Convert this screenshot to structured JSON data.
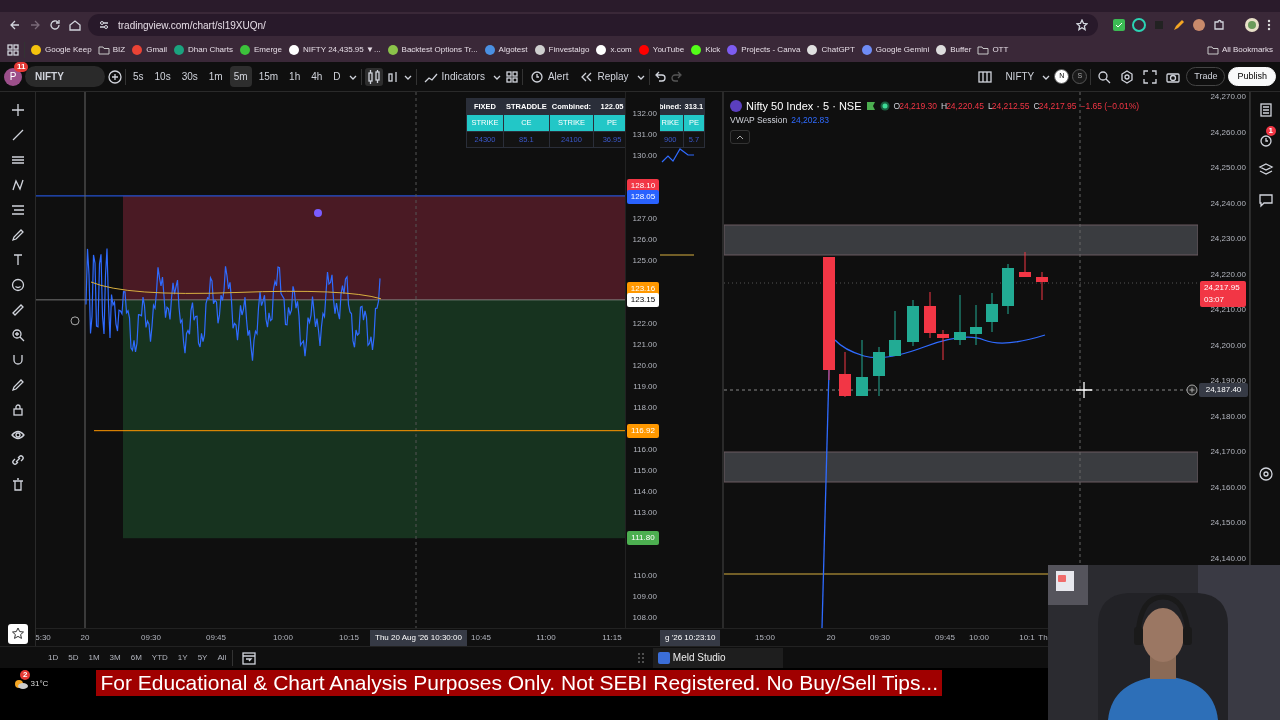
{
  "browser": {
    "url": "tradingview.com/chart/sl19XUQn/",
    "all_bookmarks": "All Bookmarks",
    "bookmarks": [
      {
        "label": "Google Keep",
        "kind": "site",
        "color": "#f4c20d"
      },
      {
        "label": "BIZ",
        "kind": "folder"
      },
      {
        "label": "Gmail",
        "kind": "site",
        "color": "#ea4335"
      },
      {
        "label": "Dhan Charts",
        "kind": "site",
        "color": "#1ba37f"
      },
      {
        "label": "Emerge",
        "kind": "site",
        "color": "#3cc13b"
      },
      {
        "label": "NIFTY 24,435.95 ▼...",
        "kind": "site",
        "color": "#ffffff"
      },
      {
        "label": "Backtest Options Tr...",
        "kind": "site",
        "color": "#8bc34a"
      },
      {
        "label": "Algotest",
        "kind": "site",
        "color": "#4a90e2"
      },
      {
        "label": "Finvestalgo",
        "kind": "site",
        "color": "#cfcfcf"
      },
      {
        "label": "x.com",
        "kind": "site",
        "color": "#ffffff"
      },
      {
        "label": "YouTube",
        "kind": "site",
        "color": "#ff0000"
      },
      {
        "label": "Kick",
        "kind": "site",
        "color": "#53fc18"
      },
      {
        "label": "Projects - Canva",
        "kind": "site",
        "color": "#7d5cf0"
      },
      {
        "label": "ChatGPT",
        "kind": "site",
        "color": "#e0e0e0"
      },
      {
        "label": "Google Gemini",
        "kind": "site",
        "color": "#6f8cf5"
      },
      {
        "label": "Buffer",
        "kind": "site",
        "color": "#dddddd"
      },
      {
        "label": "OTT",
        "kind": "folder"
      }
    ]
  },
  "toolbar": {
    "avatar": "P",
    "notifications": "11",
    "symbol": "NIFTY",
    "intervals": [
      {
        "label": "5s",
        "selected": false
      },
      {
        "label": "10s",
        "selected": false
      },
      {
        "label": "30s",
        "selected": false
      },
      {
        "label": "1m",
        "selected": false
      },
      {
        "label": "5m",
        "selected": true
      },
      {
        "label": "15m",
        "selected": false
      },
      {
        "label": "1h",
        "selected": false
      },
      {
        "label": "4h",
        "selected": false
      },
      {
        "label": "D",
        "selected": false
      }
    ],
    "indicators": "Indicators",
    "alert": "Alert",
    "replay": "Replay",
    "symbol_right": "NIFTY",
    "badges": [
      "N",
      "S"
    ],
    "trade": "Trade",
    "publish": "Publish"
  },
  "left_chart": {
    "tables": [
      {
        "header": [
          "FIXED",
          "STRADDLE",
          "Combined:",
          "122.05"
        ],
        "columns": [
          "STRIKE",
          "CE",
          "STRIKE",
          "PE"
        ],
        "values": [
          "24300",
          "85.1",
          "24100",
          "36.95"
        ]
      },
      {
        "header": [
          "bined:",
          "313.1"
        ],
        "columns": [
          "RIKE",
          "PE"
        ],
        "values": [
          "900",
          "5.7"
        ]
      }
    ],
    "price_ticks": [
      "132.00",
      "131.00",
      "130.00",
      "127.00",
      "126.00",
      "125.00",
      "122.00",
      "121.00",
      "120.00",
      "119.00",
      "118.00",
      "116.00",
      "115.00",
      "114.00",
      "113.00",
      "110.00",
      "109.00",
      "108.00"
    ],
    "price_tags": [
      {
        "label": "128.10",
        "color": "#f23645"
      },
      {
        "label": "128.05",
        "color": "#2962ff"
      },
      {
        "label": "123.16",
        "color": "#ff9800"
      },
      {
        "label": "123.15",
        "color": "#ffffff"
      },
      {
        "label": "116.92",
        "color": "#ff9800"
      },
      {
        "label": "111.80",
        "color": "#4caf50"
      }
    ],
    "time_labels": [
      "5:30",
      "20",
      "09:30",
      "09:45",
      "10:00",
      "10:15",
      "10:45",
      "11:00",
      "11:15"
    ],
    "crosshair_time": "Thu 20 Aug '26  10:30:00"
  },
  "middle_panel": {
    "crosshair_time": "g '26  10:23:10"
  },
  "right_chart": {
    "title": "Nifty 50 Index · 5 · NSE",
    "ohlc": [
      {
        "key": "O",
        "value": "24,219.30"
      },
      {
        "key": "H",
        "value": "24,220.45"
      },
      {
        "key": "L",
        "value": "24,212.55"
      },
      {
        "key": "C",
        "value": "24,217.95"
      }
    ],
    "change": "−1.65 (−0.01%)",
    "indicator": "VWAP Session",
    "indicator_value": "24,202.83",
    "price_ticks": [
      "24,270.00",
      "24,260.00",
      "24,250.00",
      "24,240.00",
      "24,230.00",
      "24,220.00",
      "24,210.00",
      "24,200.00",
      "24,190.00",
      "24,180.00",
      "24,170.00",
      "24,160.00",
      "24,150.00",
      "24,140.00"
    ],
    "last_price": "24,217.95",
    "countdown": "03:07",
    "crosshair_price": "24,187.40",
    "time_labels": [
      "15:00",
      "20",
      "09:30",
      "09:45",
      "10:00",
      "10:1",
      "Th"
    ]
  },
  "sidebar": {
    "alerts_badge": "1"
  },
  "ranges": [
    "1D",
    "5D",
    "1M",
    "3M",
    "6M",
    "YTD",
    "1Y",
    "5Y",
    "All"
  ],
  "taskbar": {
    "weather_badge": "2",
    "temperature": "31°C",
    "app": "Meld Studio"
  },
  "banner": "For Educational & Chart Analysis Purposes Only. Not SEBI Registered. No Buy/Sell Tips..."
}
